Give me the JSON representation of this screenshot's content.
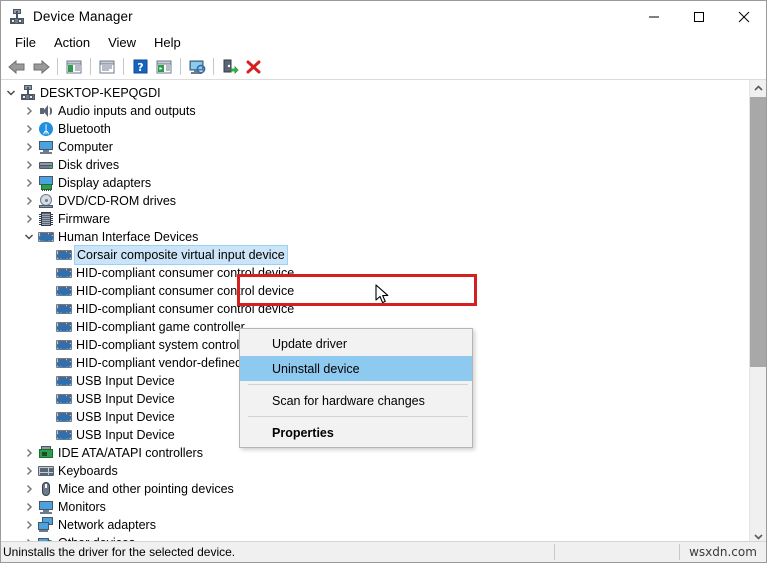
{
  "window": {
    "title": "Device Manager",
    "icon": "device-manager-icon",
    "minimize_label": "—",
    "maximize_label": "□",
    "close_label": "✕"
  },
  "menubar": {
    "items": [
      {
        "label": "File"
      },
      {
        "label": "Action"
      },
      {
        "label": "View"
      },
      {
        "label": "Help"
      }
    ]
  },
  "toolbar": {
    "buttons": [
      {
        "name": "back-icon",
        "tooltip": "Back"
      },
      {
        "name": "forward-icon",
        "tooltip": "Forward"
      },
      {
        "name": "show-hide-console-tree-icon",
        "tooltip": "Show/Hide Console Tree"
      },
      {
        "name": "properties-icon",
        "tooltip": "Properties"
      },
      {
        "name": "help-icon",
        "tooltip": "Help"
      },
      {
        "name": "show-hide-action-pane-icon",
        "tooltip": "Show/Hide Action Pane"
      },
      {
        "name": "scan-for-hardware-changes-icon",
        "tooltip": "Scan for hardware changes"
      },
      {
        "name": "update-driver-icon",
        "tooltip": "Update driver"
      },
      {
        "name": "uninstall-device-icon",
        "tooltip": "Uninstall device"
      }
    ]
  },
  "tree": {
    "nodes": [
      {
        "label": "DESKTOP-KEPQGDI",
        "depth": 0,
        "expanded": true,
        "icon": "root-computer-icon",
        "selected": false
      },
      {
        "label": "Audio inputs and outputs",
        "depth": 1,
        "expanded": false,
        "icon": "speaker-icon",
        "selected": false
      },
      {
        "label": "Bluetooth",
        "depth": 1,
        "expanded": false,
        "icon": "bluetooth-icon",
        "selected": false
      },
      {
        "label": "Computer",
        "depth": 1,
        "expanded": false,
        "icon": "monitor-icon",
        "selected": false
      },
      {
        "label": "Disk drives",
        "depth": 1,
        "expanded": false,
        "icon": "disk-drive-icon",
        "selected": false
      },
      {
        "label": "Display adapters",
        "depth": 1,
        "expanded": false,
        "icon": "display-adapter-icon",
        "selected": false
      },
      {
        "label": "DVD/CD-ROM drives",
        "depth": 1,
        "expanded": false,
        "icon": "dvd-drive-icon",
        "selected": false
      },
      {
        "label": "Firmware",
        "depth": 1,
        "expanded": false,
        "icon": "firmware-chip-icon",
        "selected": false
      },
      {
        "label": "Human Interface Devices",
        "depth": 1,
        "expanded": true,
        "icon": "hid-icon",
        "selected": false
      },
      {
        "label": "Corsair composite virtual input device",
        "depth": 2,
        "expanded": null,
        "icon": "hid-icon",
        "selected": true
      },
      {
        "label": "HID-compliant consumer control device",
        "depth": 2,
        "expanded": null,
        "icon": "hid-icon",
        "selected": false
      },
      {
        "label": "HID-compliant consumer control device",
        "depth": 2,
        "expanded": null,
        "icon": "hid-icon",
        "selected": false
      },
      {
        "label": "HID-compliant consumer control device",
        "depth": 2,
        "expanded": null,
        "icon": "hid-icon",
        "selected": false
      },
      {
        "label": "HID-compliant game controller",
        "depth": 2,
        "expanded": null,
        "icon": "hid-icon",
        "selected": false
      },
      {
        "label": "HID-compliant system controller",
        "depth": 2,
        "expanded": null,
        "icon": "hid-icon",
        "selected": false
      },
      {
        "label": "HID-compliant vendor-defined device",
        "depth": 2,
        "expanded": null,
        "icon": "hid-icon",
        "selected": false
      },
      {
        "label": "USB Input Device",
        "depth": 2,
        "expanded": null,
        "icon": "hid-icon",
        "selected": false
      },
      {
        "label": "USB Input Device",
        "depth": 2,
        "expanded": null,
        "icon": "hid-icon",
        "selected": false
      },
      {
        "label": "USB Input Device",
        "depth": 2,
        "expanded": null,
        "icon": "hid-icon",
        "selected": false
      },
      {
        "label": "USB Input Device",
        "depth": 2,
        "expanded": null,
        "icon": "hid-icon",
        "selected": false
      },
      {
        "label": "IDE ATA/ATAPI controllers",
        "depth": 1,
        "expanded": false,
        "icon": "ide-controller-icon",
        "selected": false
      },
      {
        "label": "Keyboards",
        "depth": 1,
        "expanded": false,
        "icon": "keyboard-icon",
        "selected": false
      },
      {
        "label": "Mice and other pointing devices",
        "depth": 1,
        "expanded": false,
        "icon": "mouse-icon",
        "selected": false
      },
      {
        "label": "Monitors",
        "depth": 1,
        "expanded": false,
        "icon": "monitor-icon",
        "selected": false
      },
      {
        "label": "Network adapters",
        "depth": 1,
        "expanded": false,
        "icon": "network-adapter-icon",
        "selected": false
      },
      {
        "label": "Other devices",
        "depth": 1,
        "expanded": false,
        "icon": "other-devices-icon",
        "selected": false
      }
    ]
  },
  "context_menu": {
    "items": [
      {
        "label": "Update driver",
        "highlighted": false,
        "bold": false,
        "separator_after": false
      },
      {
        "label": "Uninstall device",
        "highlighted": true,
        "bold": false,
        "separator_after": true
      },
      {
        "label": "Scan for hardware changes",
        "highlighted": false,
        "bold": false,
        "separator_after": true
      },
      {
        "label": "Properties",
        "highlighted": false,
        "bold": true,
        "separator_after": false
      }
    ],
    "highlight_color": "#8ecaf0",
    "annotation_box_color": "#d62020"
  },
  "statusbar": {
    "message": "Uninstalls the driver for the selected device.",
    "watermark": "wsxdn.com"
  },
  "scrollbar": {
    "up_arrow": "scroll-up-arrow",
    "down_arrow": "scroll-down-arrow"
  }
}
